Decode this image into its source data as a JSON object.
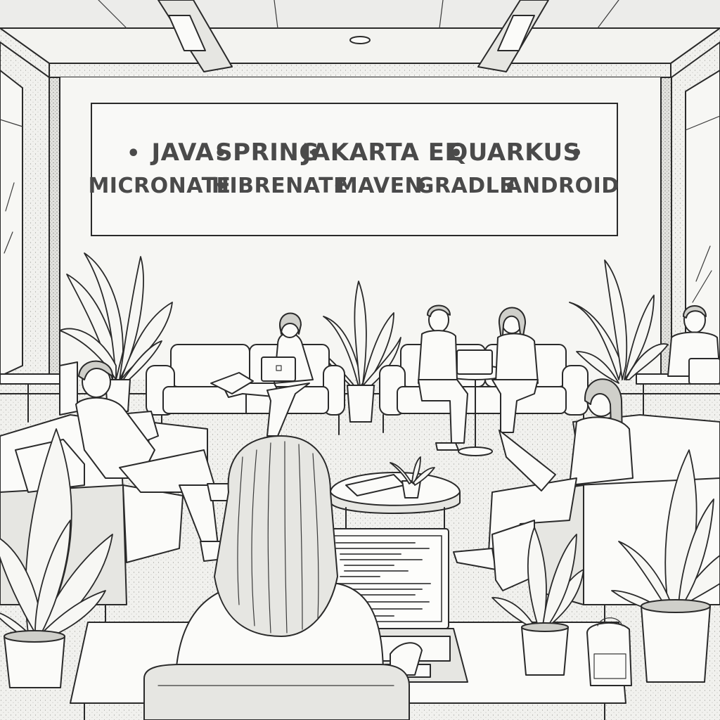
{
  "banner": {
    "line1": [
      "•",
      "JAVA",
      "•",
      "SPRING",
      "•",
      "JAKARTA EE",
      "•",
      "QUARKUS",
      "•"
    ],
    "line2": [
      "MICRONATE",
      "•",
      "HIBRENATE",
      "•",
      "MAVEN",
      "•",
      "GRADLE",
      "•",
      "ANDROID"
    ]
  },
  "palette": {
    "ink": "#2a2a2a",
    "paper": "#fbfbf9",
    "shade": "#e6e6e2",
    "banner_text": "#4a4a4a"
  }
}
